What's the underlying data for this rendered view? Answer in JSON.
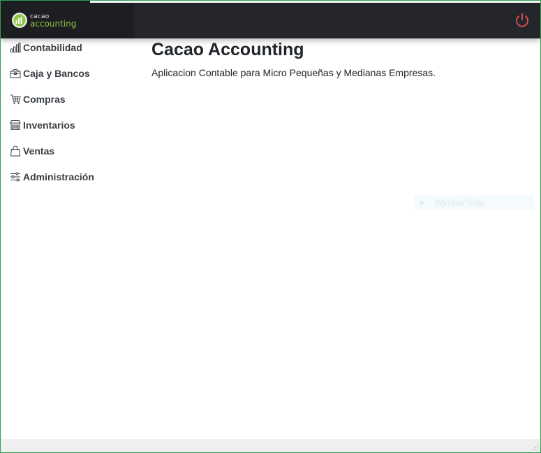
{
  "brand": {
    "line1": "cacao",
    "line2": "accounting",
    "accent_color": "#8dc63f"
  },
  "header": {
    "power_icon": "power-icon",
    "power_color": "#e05252"
  },
  "sidebar": {
    "items": [
      {
        "label": "Contabilidad",
        "icon": "bar-chart-icon"
      },
      {
        "label": "Caja y Bancos",
        "icon": "cash-box-icon"
      },
      {
        "label": "Compras",
        "icon": "cart-icon"
      },
      {
        "label": "Inventarios",
        "icon": "warehouse-icon"
      },
      {
        "label": "Ventas",
        "icon": "shopping-bag-icon"
      },
      {
        "label": "Administración",
        "icon": "sliders-icon"
      }
    ]
  },
  "main": {
    "title": "Cacao Accounting",
    "subtitle": "Aplicacion Contable para Micro Pequeñas y Medianas Empresas."
  },
  "overlay": {
    "label": "Window Snip"
  }
}
